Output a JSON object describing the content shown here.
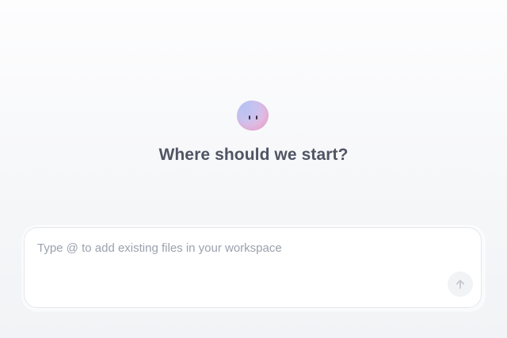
{
  "hero": {
    "mascot_icon": "smiling-blob-mascot-icon",
    "heading": "Where should we start?"
  },
  "composer": {
    "value": "",
    "placeholder": "Type @ to add existing files in your workspace",
    "send_icon": "arrow-up-icon",
    "send_enabled": false
  },
  "colors": {
    "heading": "#4f5563",
    "placeholder": "#9aa1ad",
    "send_button_bg": "#f2f3f5",
    "send_icon": "#c3c7ce"
  }
}
